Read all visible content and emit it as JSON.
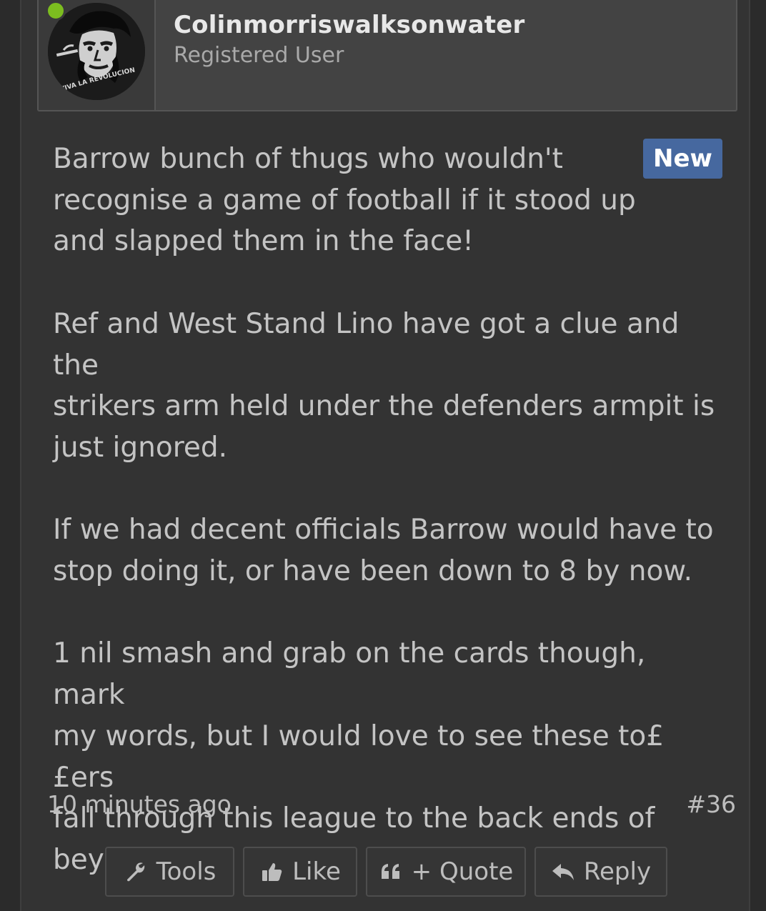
{
  "user": {
    "username": "Colinmorriswalksonwater",
    "title": "Registered User",
    "avatar_icon": "avatar-revolutionary-portrait",
    "avatar_caption": "VIVA LA REVOLUCION",
    "online_status_color": "#7cbd1f"
  },
  "post": {
    "badge": "New",
    "badge_color": "#46689f",
    "paragraphs": [
      "Barrow bunch of thugs who wouldn't\nrecognise a game of football if it stood up\nand slapped them in the face!",
      "Ref and West Stand Lino have got a clue and the\nstrikers arm held under the defenders armpit is\njust ignored.",
      "If we had decent officials Barrow would have to\nstop doing it, or have been down to 8 by now.",
      "1 nil smash and grab on the cards though, mark\nmy words, but I would love to see these to££ers\nfall through this league to the back ends of\nbeyond!"
    ],
    "time": "10 minutes ago",
    "number": "#36"
  },
  "actions": {
    "tools_label": "Tools",
    "tools_icon": "wrench-icon",
    "like_label": "Like",
    "like_icon": "thumbs-up-icon",
    "quote_label": "+ Quote",
    "quote_icon": "quote-icon",
    "reply_label": "Reply",
    "reply_icon": "reply-arrow-icon"
  }
}
